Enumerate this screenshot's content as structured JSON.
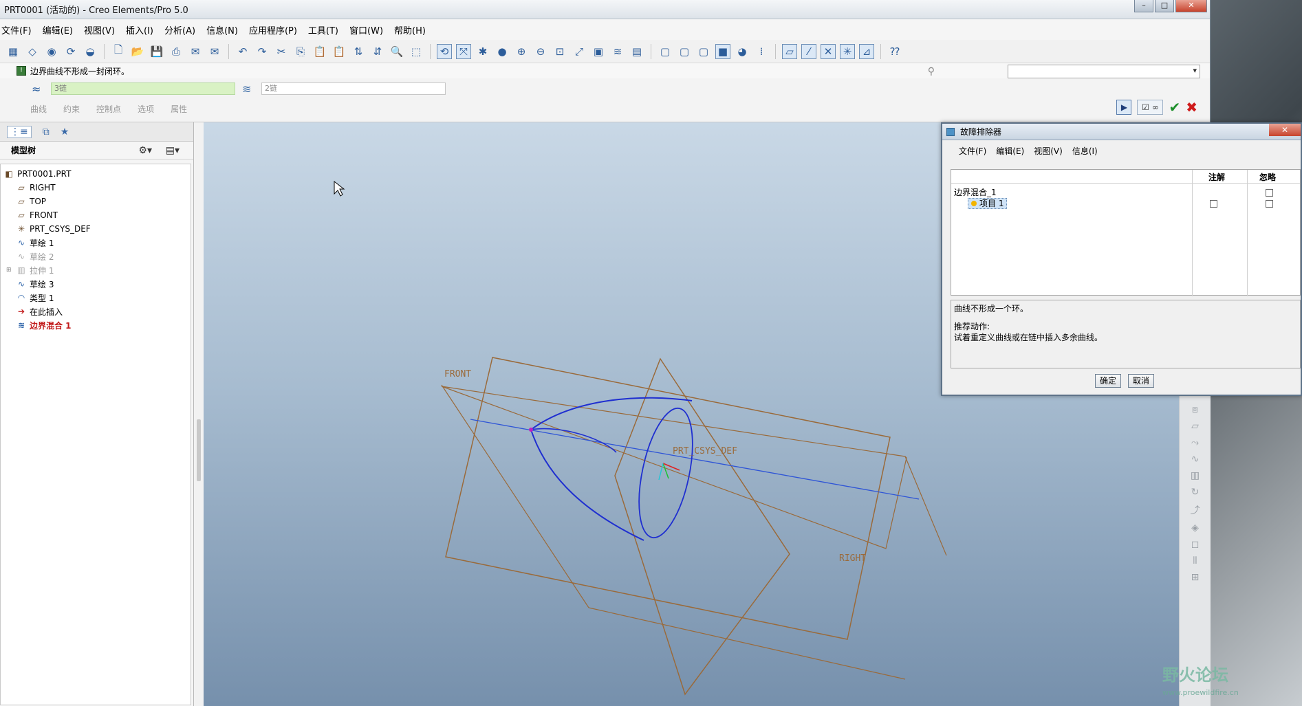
{
  "window": {
    "title": "PRT0001 (活动的) - Creo Elements/Pro 5.0"
  },
  "menu": [
    "文件(F)",
    "编辑(E)",
    "视图(V)",
    "插入(I)",
    "分析(A)",
    "信息(N)",
    "应用程序(P)",
    "工具(T)",
    "窗口(W)",
    "帮助(H)"
  ],
  "message": "边界曲线不形成一封闭环。",
  "dashboard": {
    "chain1": "3链",
    "chain2": "2链",
    "tabs": [
      "曲线",
      "约束",
      "控制点",
      "选项",
      "属性"
    ]
  },
  "model_tree": {
    "header": "模型树",
    "items": [
      {
        "label": "PRT0001.PRT",
        "icon": "part-icon",
        "state": "normal"
      },
      {
        "label": "RIGHT",
        "icon": "datum-plane-icon",
        "state": "normal"
      },
      {
        "label": "TOP",
        "icon": "datum-plane-icon",
        "state": "normal"
      },
      {
        "label": "FRONT",
        "icon": "datum-plane-icon",
        "state": "normal"
      },
      {
        "label": "PRT_CSYS_DEF",
        "icon": "csys-icon",
        "state": "normal"
      },
      {
        "label": "草绘 1",
        "icon": "sketch-icon",
        "state": "normal"
      },
      {
        "label": "草绘 2",
        "icon": "sketch-icon",
        "state": "dim"
      },
      {
        "label": "拉伸 1",
        "icon": "extrude-icon",
        "state": "dim"
      },
      {
        "label": "草绘 3",
        "icon": "sketch-icon",
        "state": "normal"
      },
      {
        "label": "类型 1",
        "icon": "style-icon",
        "state": "normal"
      },
      {
        "label": "在此插入",
        "icon": "insert-arrow-icon",
        "state": "insert"
      },
      {
        "label": "边界混合 1",
        "icon": "boundary-blend-icon",
        "state": "active"
      }
    ]
  },
  "viewport": {
    "labels": {
      "front": "FRONT",
      "right": "RIGHT",
      "csys": "PRT_CSYS_DEF"
    }
  },
  "dialog": {
    "title": "故障排除器",
    "menu": [
      "文件(F)",
      "编辑(E)",
      "视图(V)",
      "信息(I)"
    ],
    "col_note": "注解",
    "col_ignore": "忽略",
    "row1": "边界混合_1",
    "row2": "项目 1",
    "msg1": "曲线不形成一个环。",
    "msg2": "推荐动作:",
    "msg3": "试着重定义曲线或在链中插入多余曲线。",
    "ok": "确定",
    "cancel": "取消"
  },
  "watermark": {
    "text": "野火论坛",
    "sub": "www.proewildfire.cn"
  }
}
